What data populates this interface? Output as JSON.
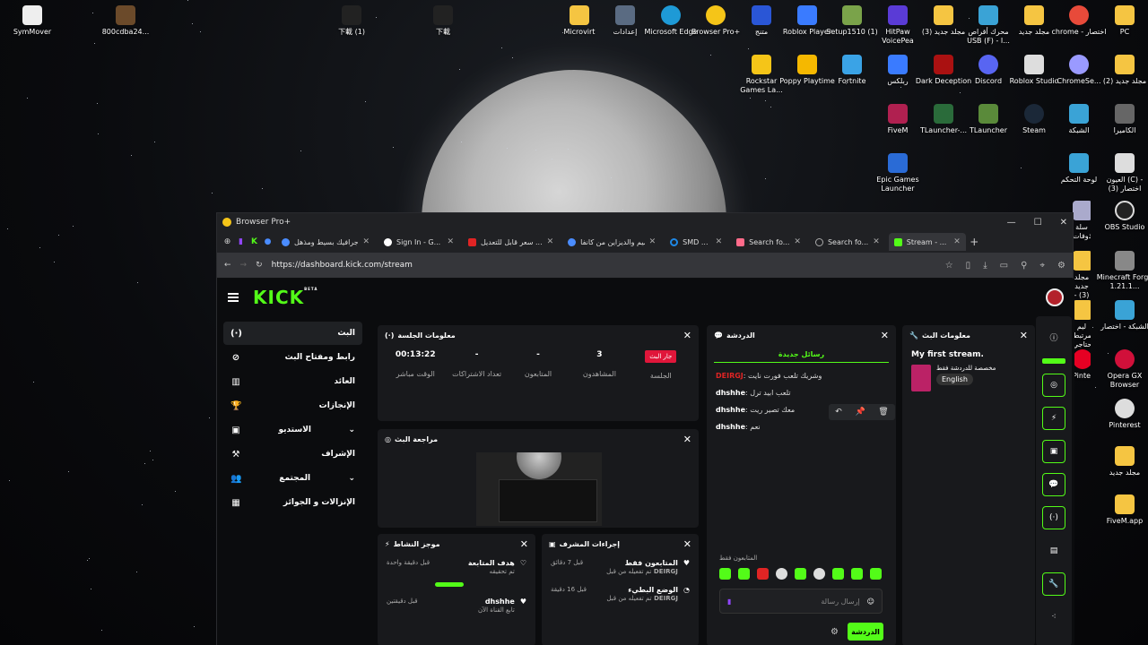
{
  "desktop": {
    "icons": [
      {
        "label": "SymMover"
      },
      {
        "label": "800cdba24..."
      },
      {
        "label": "下載 (1)"
      },
      {
        "label": "下載"
      },
      {
        "label": "Microvirt"
      },
      {
        "label": "إعدادات"
      },
      {
        "label": "Microsoft Edge"
      },
      {
        "label": "Browser Pro+"
      },
      {
        "label": "متنج"
      },
      {
        "label": "Roblox Player"
      },
      {
        "label": "Setup1510 (1)"
      },
      {
        "label": "HitPaw VoicePea"
      },
      {
        "label": "مجلد جديد (3)"
      },
      {
        "label": "محرك أقراص USB (F) - I..."
      },
      {
        "label": "مجلد جديد"
      },
      {
        "label": "chrome - اختصار"
      },
      {
        "label": "PC"
      },
      {
        "label": "Rockstar Games La..."
      },
      {
        "label": "Poppy Playtime"
      },
      {
        "label": "Fortnite"
      },
      {
        "label": "ربلكس"
      },
      {
        "label": "Dark Deception"
      },
      {
        "label": "Discord"
      },
      {
        "label": "Roblox Studio"
      },
      {
        "label": "ChromeSe..."
      },
      {
        "label": "مجلد جديد (2)"
      },
      {
        "label": "FiveM"
      },
      {
        "label": "TLauncher-..."
      },
      {
        "label": "TLauncher"
      },
      {
        "label": "Steam"
      },
      {
        "label": "الشبكة"
      },
      {
        "label": "الكاميرا"
      },
      {
        "label": "Epic Games Launcher"
      },
      {
        "label": "لوحة التحكم"
      },
      {
        "label": "العيون (C) - اختصار (3)"
      },
      {
        "label": "سلة المحذوفات"
      },
      {
        "label": "OBS Studio"
      },
      {
        "label": "مجلد جديد (3) - نسخة"
      },
      {
        "label": "Minecraft Forge 1.21.1..."
      },
      {
        "label": "ليم المرتبط بحتاجي..."
      },
      {
        "label": "الشبكة - اختصار"
      },
      {
        "label": "Pinterest"
      },
      {
        "label": "Opera GX Browser"
      },
      {
        "label": "Pinterest"
      },
      {
        "label": "مجلد جديد"
      },
      {
        "label": "FiveM.app"
      }
    ]
  },
  "browser": {
    "title": "Browser Pro+",
    "tabs": [
      {
        "label": "جرافيك بسيط ومذهل ...",
        "color": "#4a8cff"
      },
      {
        "label": "Sign In - G...",
        "color": "#ffffff"
      },
      {
        "label": "سعر قابل للتعديل ...",
        "color": "#e02424"
      },
      {
        "label": "تصميم والديزاين من كانفا ...",
        "color": "#4a8cff"
      },
      {
        "label": "SMD ...",
        "color": "#1e88e5"
      },
      {
        "label": "Search fo...",
        "color": "#ff6b8a"
      },
      {
        "label": "Search fo...",
        "color": "#aaaaaa"
      },
      {
        "label": "Stream - ...",
        "color": "#53fc18"
      }
    ],
    "url": "https://dashboard.kick.com/stream"
  },
  "kick": {
    "logo": "KICK",
    "beta": "BETA",
    "nav": [
      {
        "label": "البث",
        "icon": "(·)"
      },
      {
        "label": "رابط ومفتاح البث",
        "icon": "⊘"
      },
      {
        "label": "العائد",
        "icon": "▥"
      },
      {
        "label": "الإنجازات",
        "icon": "🏆"
      },
      {
        "label": "الاستديو",
        "icon": "▣"
      },
      {
        "label": "الإشراف",
        "icon": "⚒"
      },
      {
        "label": "المجتمع",
        "icon": "👥"
      },
      {
        "label": "الإنزالات و الجوائز",
        "icon": "▦"
      }
    ],
    "session": {
      "title": "معلومات الجلسة",
      "badge": "جار البث",
      "session_label": "الجلسة",
      "stats": [
        {
          "value": "00:13:22",
          "label": "الوقت مباشر"
        },
        {
          "value": "-",
          "label": "تعداد الاشتراكات"
        },
        {
          "value": "-",
          "label": "المتابعون"
        },
        {
          "value": "3",
          "label": "المشاهدون"
        }
      ]
    },
    "preview": {
      "title": "مراجعة البث"
    },
    "activity": {
      "title": "موجز النشاط",
      "rows": [
        {
          "title": "هدف المتابعة",
          "sub": "تم تحقيقه",
          "time": "قبل دقيقة واحدة"
        },
        {
          "title": "dhshhe",
          "sub": "تابع القناة الآن",
          "time": "قبل دقيقتين"
        }
      ]
    },
    "modactions": {
      "title": "إجراءات المشرف",
      "rows": [
        {
          "title": "المتابعون فقط",
          "sub": "DEIRGJ",
          "sub2": "تم تفعيله من قبل",
          "time": "قبل 7 دقائق"
        },
        {
          "title": "الوضع البطيء",
          "sub": "DEIRGJ",
          "sub2": "تم تفعيله من قبل",
          "time": "قبل 16 دقيقة"
        }
      ]
    },
    "chat": {
      "title": "الدردشة",
      "new_messages": "رسائل جديدة",
      "messages": [
        {
          "user": "DEIRGJ",
          "text": "وشريك تلعب فورت نايت"
        },
        {
          "user": "dhshhe",
          "text": "تلعب ابيد ترل"
        },
        {
          "user": "dhshhe",
          "text": "معك تصير ريت"
        },
        {
          "user": "dhshhe",
          "text": "نعم"
        }
      ],
      "followers_only": "المتابعون فقط",
      "placeholder": "إرسال رسالة",
      "send": "الدردشة"
    },
    "streaminfo": {
      "title": "معلومات البث",
      "stream_title": "My first stream.",
      "category": "مخصصة للدردشة فقط",
      "language": "English"
    }
  }
}
